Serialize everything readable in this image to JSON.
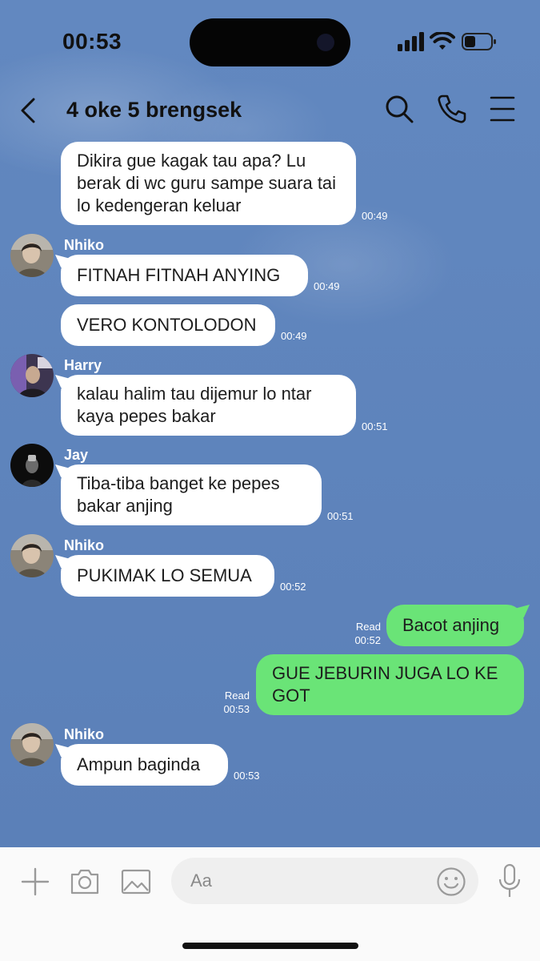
{
  "status_bar": {
    "time": "00:53"
  },
  "header": {
    "title": "4 oke 5 brengsek"
  },
  "messages": [
    {
      "type": "incoming",
      "text": "Dikira gue kagak tau apa? Lu berak di wc guru sampe suara tai lo kedengeran keluar",
      "time": "00:49"
    },
    {
      "type": "incoming",
      "sender": "Nhiko",
      "text": "FITNAH FITNAH ANYING",
      "time": "00:49"
    },
    {
      "type": "incoming",
      "text": "VERO KONTOLODON",
      "time": "00:49"
    },
    {
      "type": "incoming",
      "sender": "Harry",
      "text": "kalau halim tau dijemur lo ntar kaya pepes bakar",
      "time": "00:51"
    },
    {
      "type": "incoming",
      "sender": "Jay",
      "text": "Tiba-tiba banget ke pepes bakar anjing",
      "time": "00:51"
    },
    {
      "type": "incoming",
      "sender": "Nhiko",
      "text": "PUKIMAK LO SEMUA",
      "time": "00:52"
    },
    {
      "type": "outgoing",
      "text": "Bacot anjing",
      "read": "Read",
      "time": "00:52"
    },
    {
      "type": "outgoing",
      "text": "GUE JEBURIN JUGA LO KE GOT",
      "read": "Read",
      "time": "00:53"
    },
    {
      "type": "incoming",
      "sender": "Nhiko",
      "text": "Ampun baginda",
      "time": "00:53"
    }
  ],
  "input": {
    "placeholder": "Aa"
  },
  "icons": {
    "back": "chevron-left-icon",
    "search": "search-icon",
    "call": "phone-icon",
    "menu": "menu-icon",
    "add": "plus-icon",
    "camera": "camera-icon",
    "image": "image-icon",
    "emoji": "emoji-icon",
    "mic": "microphone-icon"
  },
  "colors": {
    "chat_background": "#5f83ba",
    "outgoing_bubble": "#6ae477",
    "incoming_bubble": "#ffffff"
  }
}
